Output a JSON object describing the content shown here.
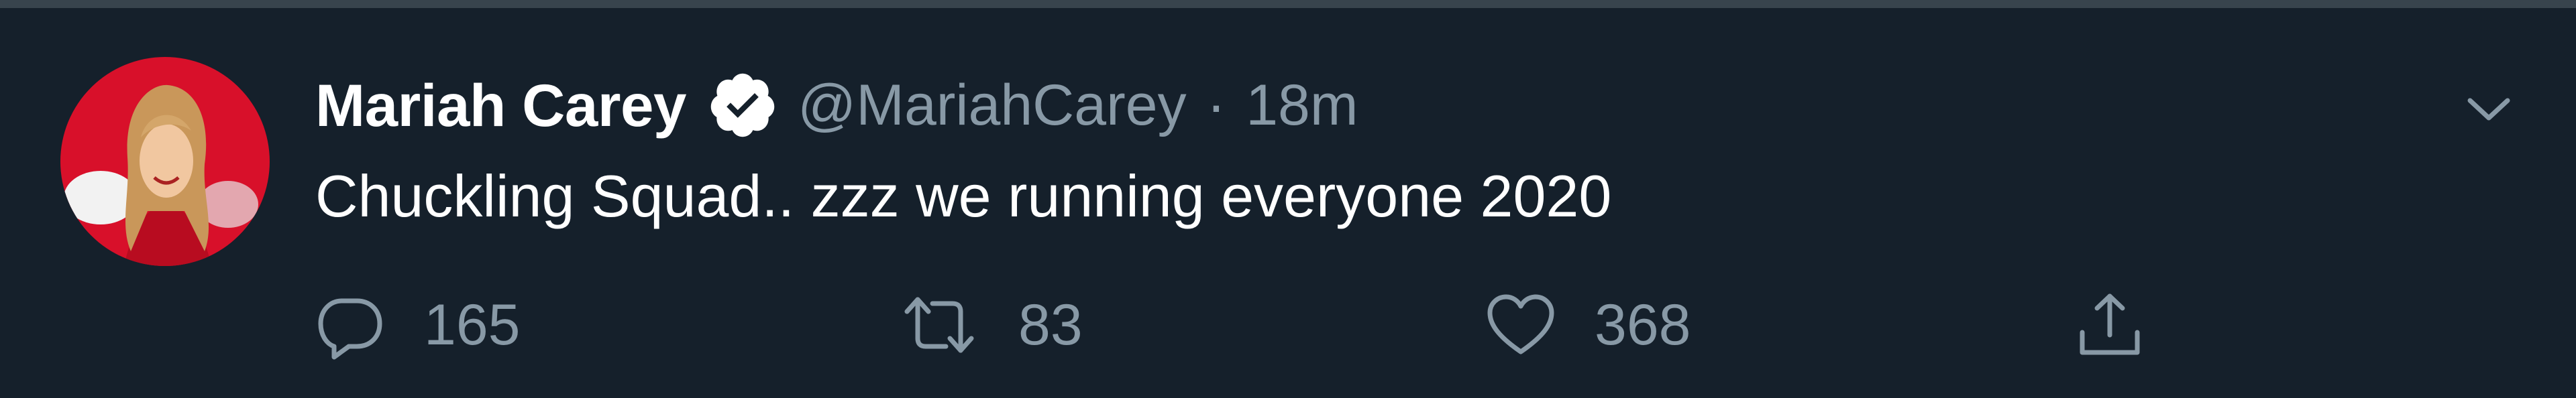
{
  "tweet": {
    "author_name": "Mariah Carey",
    "verified_icon": "verified-badge-icon",
    "handle": "@MariahCarey",
    "separator": "·",
    "time": "18m",
    "text": "Chuckling Squad.. zzz we running everyone 2020",
    "caret_icon": "chevron-down-icon",
    "actions": {
      "reply": {
        "icon": "comment-icon",
        "count": "165"
      },
      "retweet": {
        "icon": "retweet-icon",
        "count": "83"
      },
      "like": {
        "icon": "heart-icon",
        "count": "368"
      },
      "share": {
        "icon": "share-icon"
      }
    }
  },
  "colors": {
    "background": "#15202b",
    "border": "#38444d",
    "primary_text": "#ffffff",
    "secondary_text": "#8899a6",
    "avatar_red": "#d8102a"
  }
}
